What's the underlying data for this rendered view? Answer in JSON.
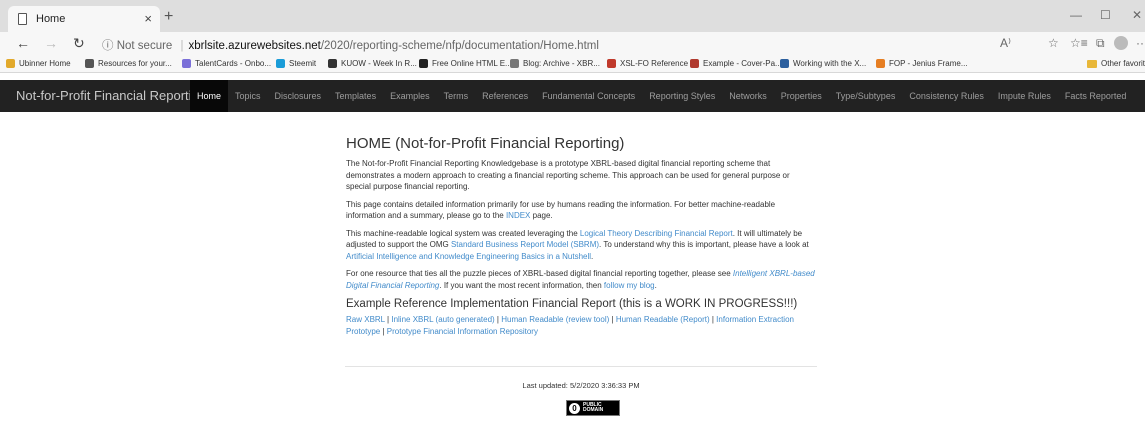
{
  "browser": {
    "tab_title": "Home",
    "tab_close": "×",
    "new_tab": "+",
    "window_min": "—",
    "window_max": "☐",
    "window_close": "✕",
    "back": "←",
    "forward": "→",
    "refresh": "↻",
    "security_icon": "ⓘ",
    "security_label": "Not secure",
    "url_separator": "|",
    "url_host": "xbrlsite.azurewebsites.net",
    "url_path": "/2020/reporting-scheme/nfp/documentation/Home.html",
    "read_aloud": "A⁾",
    "favorite_star": "☆",
    "favorites_bar": "☆≡",
    "collections": "⧉",
    "more": "···"
  },
  "bookmarks": [
    {
      "label": "Ubinner Home",
      "icon_color": "#e2a92b"
    },
    {
      "label": "Resources for your...",
      "icon_color": "#555555"
    },
    {
      "label": "TalentCards - Onbo...",
      "icon_color": "#7a6fd8"
    },
    {
      "label": "Steemit",
      "icon_color": "#1a9cd8"
    },
    {
      "label": "KUOW - Week In R...",
      "icon_color": "#333333"
    },
    {
      "label": "Free Online HTML E...",
      "icon_color": "#222222"
    },
    {
      "label": "Blog: Archive - XBR...",
      "icon_color": "#777777"
    },
    {
      "label": "XSL-FO Reference",
      "icon_color": "#c0392b"
    },
    {
      "label": "Example - Cover-Pa...",
      "icon_color": "#b03a2e"
    },
    {
      "label": "Working with the X...",
      "icon_color": "#2c5f9e"
    },
    {
      "label": "FOP - Jenius Frame...",
      "icon_color": "#e67e22"
    }
  ],
  "bookmarks_other": "Other favorites",
  "site_nav": {
    "brand": "Not-for-Profit Financial Reporting",
    "links": [
      "Home",
      "Topics",
      "Disclosures",
      "Templates",
      "Examples",
      "Terms",
      "References",
      "Fundamental Concepts",
      "Reporting Styles",
      "Networks",
      "Properties",
      "Type/Subtypes",
      "Consistency Rules",
      "Impute Rules",
      "Facts Reported"
    ]
  },
  "content": {
    "heading": "HOME (Not-for-Profit Financial Reporting)",
    "p1": "The Not-for-Profit Financial Reporting Knowledgebase is a prototype XBRL-based digital financial reporting scheme that demonstrates a modern approach to creating a financial reporting scheme. This approach can be used for general purpose or special purpose financial reporting.",
    "p2_a": "This page contains detailed information primarily for use by humans reading the information. For better machine-readable information and a summary, please go to the ",
    "p2_link": "INDEX",
    "p2_b": " page.",
    "p3_a": "This machine-readable logical system was created leveraging the ",
    "p3_link1": "Logical Theory Describing Financial Report",
    "p3_b": ". It will ultimately be adjusted to support the OMG ",
    "p3_link2": "Standard Business Report Model (SBRM)",
    "p3_c": ". To understand why this is important, please have a look at ",
    "p3_link3": "Artificial Intelligence and Knowledge Engineering Basics in a Nutshell",
    "p3_d": ".",
    "p4_a": "For one resource that ties all the puzzle pieces of XBRL-based digital financial reporting together, please see ",
    "p4_link1": "Intelligent XBRL-based Digital Financial Reporting",
    "p4_b": ". If you want the most recent information, then ",
    "p4_link2": "follow my blog",
    "p4_c": ".",
    "subheading": "Example Reference Implementation Financial Report (this is a WORK IN PROGRESS!!!)",
    "links": [
      "Raw XBRL",
      "Inline XBRL (auto generated)",
      "Human Readable (review tool)",
      "Human Readable (Report)",
      "Information Extraction Prototype",
      "Prototype Financial Information Repository"
    ],
    "link_separator": " | "
  },
  "footer": {
    "last_updated": "Last updated: 5/2/2020 3:36:33 PM",
    "badge_symbol": "0",
    "badge_line1": "PUBLIC",
    "badge_line2": "DOMAIN"
  }
}
